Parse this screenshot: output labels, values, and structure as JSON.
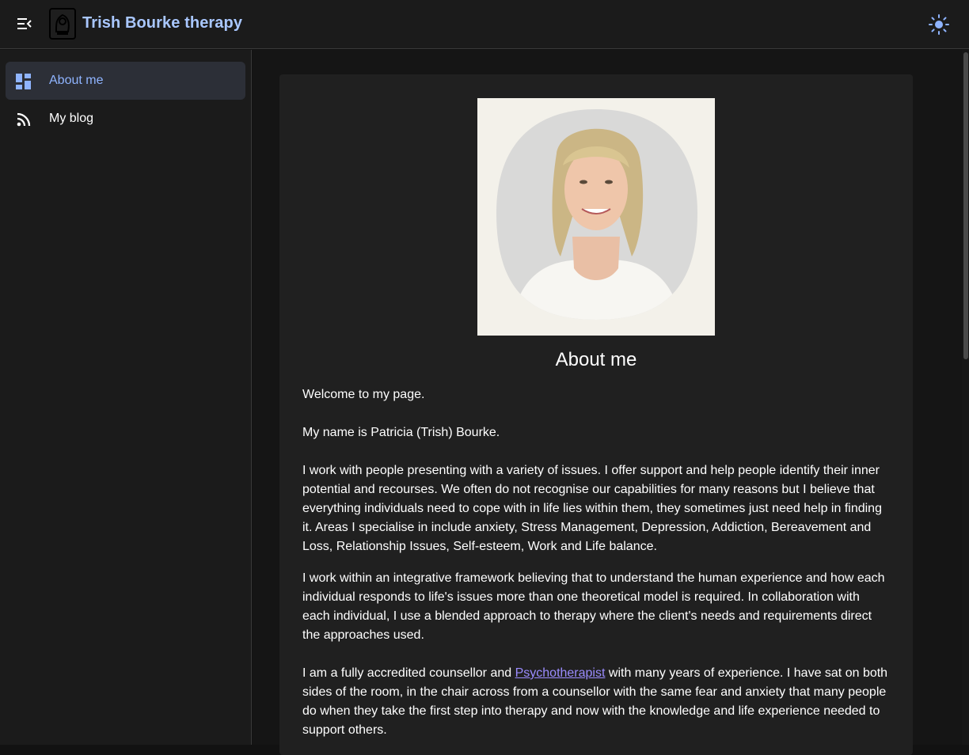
{
  "app": {
    "title": "Trish Bourke therapy"
  },
  "sidebar": {
    "items": [
      {
        "label": "About me",
        "icon": "dashboard-icon",
        "active": true
      },
      {
        "label": "My blog",
        "icon": "rss-icon",
        "active": false
      }
    ]
  },
  "content": {
    "heading": "About me",
    "welcome": "Welcome to my page.",
    "name_line": "My name is Patricia (Trish) Bourke.",
    "para1": "I work with people presenting with a variety of issues. I offer support and help people identify their inner potential and recourses. We often do not recognise our capabilities for many reasons but I believe that everything individuals need to cope with in life lies within them, they sometimes just need help in finding it. Areas I specialise in include anxiety, Stress Management, Depression, Addiction, Bereavement and Loss, Relationship Issues, Self-esteem, Work and Life balance.",
    "para2": "I work within an integrative framework believing that to understand the human experience and how each individual responds to life's issues more than one theoretical model is required. In collaboration with each individual, I use a blended approach to therapy where the client's needs and requirements direct the approaches used.",
    "para3_before": "I am a fully accredited counsellor and ",
    "para3_link": "Psychotherapist",
    "para3_after": " with many years of experience. I have sat on both sides of the room, in the chair across from a counsellor with the same fear and anxiety that many people do when they take the first step into therapy and now with the knowledge and life experience needed to support others."
  },
  "colors": {
    "accent": "#a9c7ff",
    "active_nav": "#8fb4ff",
    "link": "#9b8cff",
    "background": "#121212",
    "card": "#202020"
  },
  "icons": {
    "menu": "menu-collapse-icon",
    "logo": "logo-icon",
    "theme": "sun-icon"
  }
}
